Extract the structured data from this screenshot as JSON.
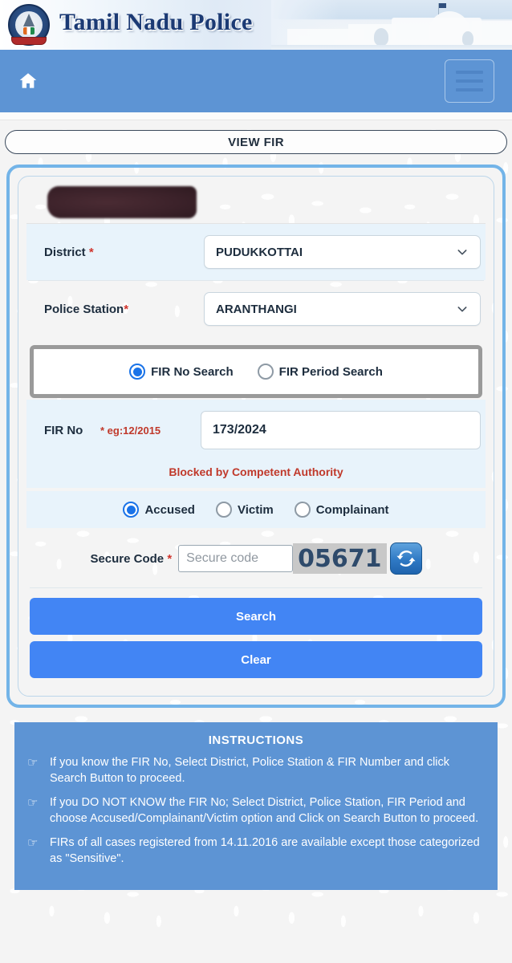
{
  "header": {
    "brand_title": "Tamil Nadu Police",
    "crest_icon": "tn-police-emblem-icon",
    "building_photo": "police-headquarters-photo"
  },
  "navbar": {
    "home_icon": "home-icon",
    "menu_icon": "hamburger-menu-icon"
  },
  "page": {
    "title": "VIEW FIR"
  },
  "form": {
    "redacted_text": "",
    "district": {
      "label": "District",
      "required_mark": "*",
      "value": "PUDUKKOTTAI",
      "chevron_icon": "chevron-down-icon"
    },
    "police_station": {
      "label": "Police Station",
      "required_mark": "*",
      "value": "ARANTHANGI",
      "chevron_icon": "chevron-down-icon"
    },
    "search_mode": {
      "options": [
        {
          "label": "FIR No Search",
          "selected": true
        },
        {
          "label": "FIR Period Search",
          "selected": false
        }
      ]
    },
    "fir_no": {
      "label": "FIR No",
      "hint": "* eg:12/2015",
      "value": "173/2024"
    },
    "error_message": "Blocked by Competent Authority",
    "person_type": {
      "options": [
        {
          "label": "Accused",
          "selected": true
        },
        {
          "label": "Victim",
          "selected": false
        },
        {
          "label": "Complainant",
          "selected": false
        }
      ]
    },
    "secure_code": {
      "label": "Secure Code",
      "required_mark": "*",
      "value": "",
      "placeholder": "Secure code",
      "captcha_text": "05671",
      "refresh_icon": "refresh-captcha-icon"
    },
    "buttons": {
      "search_label": "Search",
      "clear_label": "Clear"
    }
  },
  "instructions": {
    "title": "INSTRUCTIONS",
    "bullet_icon": "pointing-hand-icon",
    "items": [
      "If you know the FIR No, Select District, Police Station & FIR Number and click Search Button to proceed.",
      "If you DO NOT KNOW the FIR No; Select District, Police Station, FIR Period and choose Accused/Complainant/Victim option and Click on Search Button to proceed.",
      "FIRs of all cases registered from 14.11.2016 are available except those categorized as \"Sensitive\"."
    ]
  },
  "colors": {
    "nav_blue": "#5d94d4",
    "button_blue": "#4285f4",
    "accent_border": "#73b4e8",
    "error_red": "#c0392b",
    "field_bg": "#e8f3fb"
  }
}
